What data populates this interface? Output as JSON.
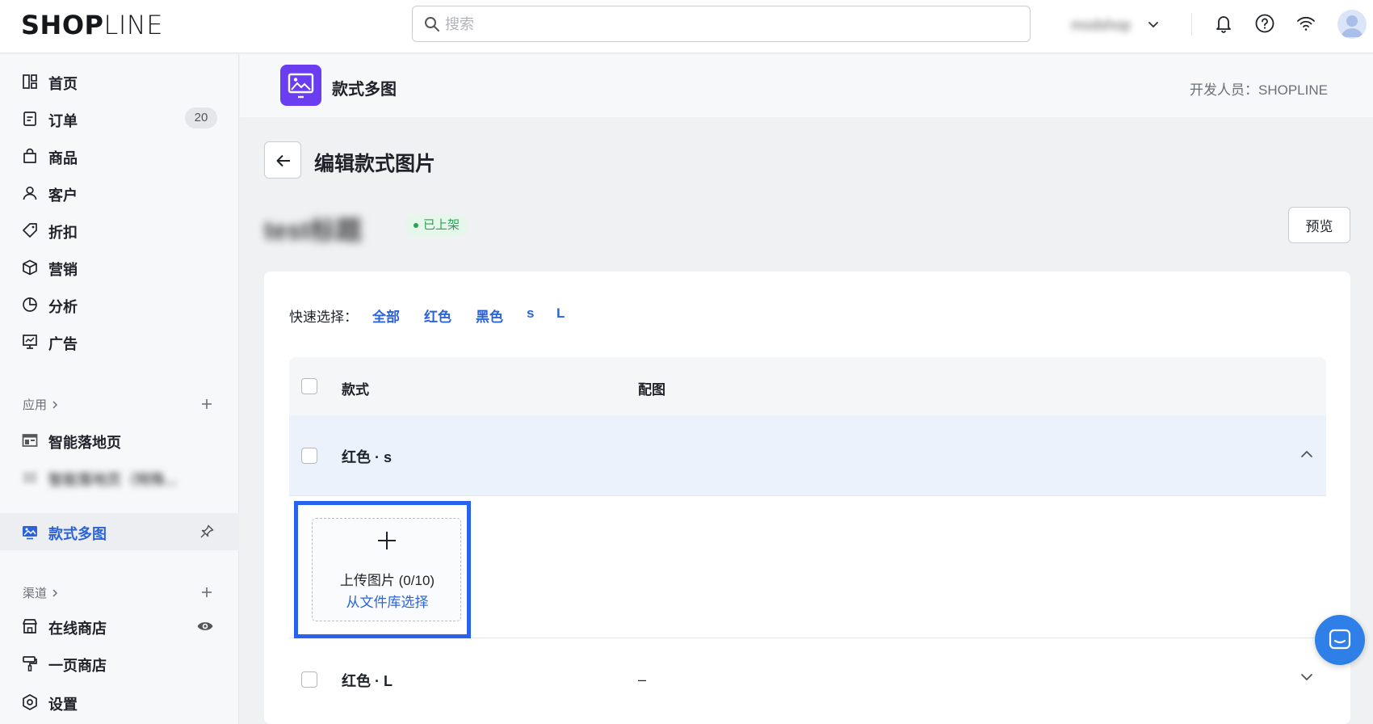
{
  "topbar": {
    "logo": {
      "bold": "SHOP",
      "light": "LINE"
    },
    "search_placeholder": "搜索",
    "shop_name": "modshop",
    "icons": [
      "search-icon",
      "chevron-down-icon",
      "bell-icon",
      "help-icon",
      "wifi-icon",
      "avatar"
    ]
  },
  "sidebar": {
    "items": [
      {
        "label": "首页",
        "icon": "home-icon"
      },
      {
        "label": "订单",
        "icon": "order-icon",
        "badge": "20"
      },
      {
        "label": "商品",
        "icon": "bag-icon"
      },
      {
        "label": "客户",
        "icon": "user-icon"
      },
      {
        "label": "折扣",
        "icon": "tag-icon"
      },
      {
        "label": "营销",
        "icon": "box-icon"
      },
      {
        "label": "分析",
        "icon": "pie-icon"
      },
      {
        "label": "广告",
        "icon": "ad-icon"
      }
    ],
    "apps_label": "应用",
    "apps": [
      {
        "label": "智能落地页",
        "icon": "landing-icon"
      },
      {
        "label": "智能落地页（特殊...",
        "icon": "landing-icon",
        "blurred": true
      }
    ],
    "active_app": {
      "label": "款式多图",
      "icon": "gallery-icon"
    },
    "channels_label": "渠道",
    "channels": [
      {
        "label": "在线商店",
        "icon": "store-icon"
      },
      {
        "label": "一页商店",
        "icon": "brush-icon"
      }
    ],
    "settings": {
      "label": "设置",
      "icon": "settings-icon"
    }
  },
  "app_header": {
    "title": "款式多图",
    "developer": "开发人员：SHOPLINE"
  },
  "page": {
    "title": "编辑款式图片",
    "product_name": "test标题",
    "status": "已上架",
    "preview_label": "预览"
  },
  "card": {
    "quick_select_label": "快速选择：",
    "quick_options": [
      "全部",
      "红色",
      "黑色",
      "s",
      "L"
    ],
    "columns": [
      "款式",
      "配图"
    ],
    "rows": [
      {
        "variant": "红色 · s",
        "expanded": true,
        "image": ""
      },
      {
        "variant": "红色 · L",
        "expanded": false,
        "image": "–"
      }
    ],
    "upload": {
      "text": "上传图片 (0/10)",
      "link": "从文件库选择"
    }
  },
  "colors": {
    "accent": "#2c63d8",
    "app_icon": "#6a3ef0",
    "status_green": "#2f9e58",
    "highlight": "#2a62f0"
  }
}
